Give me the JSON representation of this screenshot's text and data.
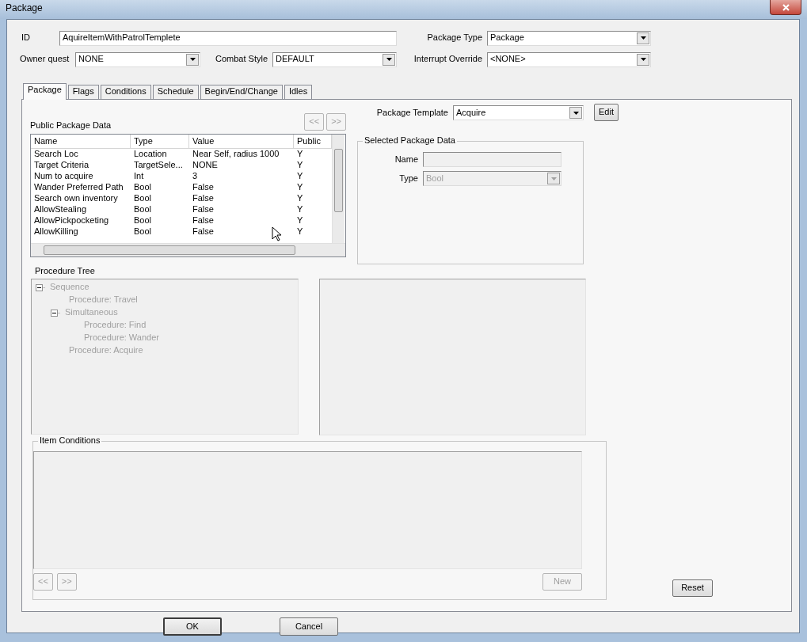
{
  "window": {
    "title": "Package"
  },
  "id_field": {
    "label": "ID",
    "value": "AquireItemWithPatrolTemplete"
  },
  "package_type": {
    "label": "Package Type",
    "value": "Package"
  },
  "owner_quest": {
    "label": "Owner quest",
    "value": "NONE"
  },
  "combat_style": {
    "label": "Combat Style",
    "value": "DEFAULT"
  },
  "interrupt_override": {
    "label": "Interrupt Override",
    "value": "<NONE>"
  },
  "tabs": [
    {
      "label": "Package",
      "selected": true
    },
    {
      "label": "Flags",
      "selected": false
    },
    {
      "label": "Conditions",
      "selected": false
    },
    {
      "label": "Schedule",
      "selected": false
    },
    {
      "label": "Begin/End/Change",
      "selected": false
    },
    {
      "label": "Idles",
      "selected": false
    }
  ],
  "public_package_data": {
    "label": "Public Package Data",
    "buttons": [
      {
        "label": "<<",
        "disabled": true
      },
      {
        "label": ">>",
        "disabled": true
      }
    ],
    "columns": [
      "Name",
      "Type",
      "Value",
      "Public"
    ],
    "rows": [
      [
        "Search Loc",
        "Location",
        "Near Self, radius 1000",
        "Y"
      ],
      [
        "Target Criteria",
        "TargetSele...",
        "NONE",
        "Y"
      ],
      [
        "Num to acquire",
        "Int",
        "3",
        "Y"
      ],
      [
        "Wander Preferred Path",
        "Bool",
        "False",
        "Y"
      ],
      [
        "Search own inventory",
        "Bool",
        "False",
        "Y"
      ],
      [
        "AllowStealing",
        "Bool",
        "False",
        "Y"
      ],
      [
        "AllowPickpocketing",
        "Bool",
        "False",
        "Y"
      ],
      [
        "AllowKilling",
        "Bool",
        "False",
        "Y"
      ]
    ]
  },
  "package_template": {
    "label": "Package Template",
    "value": "Acquire"
  },
  "edit_button": {
    "label": "Edit",
    "disabled": false
  },
  "selected_package_data": {
    "title": "Selected Package Data",
    "name": {
      "label": "Name",
      "disabled": true
    },
    "type": {
      "label": "Type",
      "value": "Bool",
      "disabled": true
    }
  },
  "procedure_tree": {
    "label": "Procedure Tree",
    "disabled": true,
    "items": [
      {
        "label": "Sequence",
        "expanded": true,
        "children": [
          {
            "label": "Procedure: Travel"
          },
          {
            "label": "Simultaneous",
            "expanded": true,
            "children": [
              {
                "label": "Procedure: Find"
              },
              {
                "label": "Procedure: Wander"
              }
            ]
          },
          {
            "label": "Procedure: Acquire"
          }
        ]
      }
    ]
  },
  "item_conditions": {
    "title": "Item Conditions",
    "nav_buttons": [
      {
        "label": "<<",
        "disabled": true
      },
      {
        "label": ">>",
        "disabled": true
      }
    ],
    "new_button": {
      "label": "New",
      "disabled": true
    }
  },
  "reset_button": {
    "label": "Reset",
    "disabled": false
  },
  "dialog_buttons": [
    {
      "label": "OK",
      "default": true
    },
    {
      "label": "Cancel",
      "default": false
    }
  ]
}
